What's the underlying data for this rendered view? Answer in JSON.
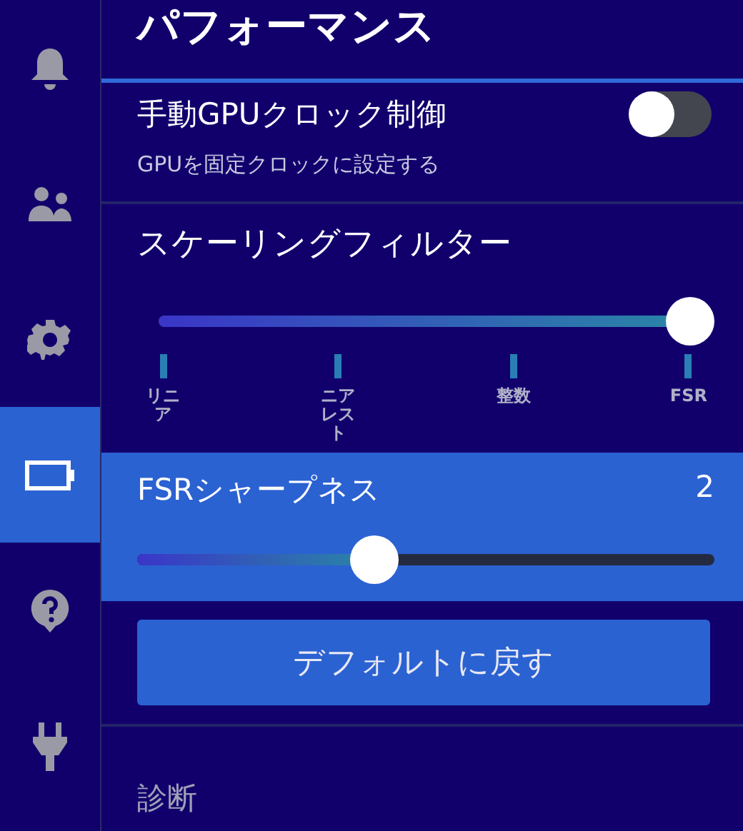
{
  "sidebar": {
    "items": [
      {
        "selected": false
      },
      {
        "selected": false
      },
      {
        "selected": false
      },
      {
        "selected": true
      },
      {
        "selected": false
      },
      {
        "selected": false
      }
    ]
  },
  "title": "パフォーマンス",
  "gpu_clock": {
    "label": "手動GPUクロック制御",
    "description": "GPUを固定クロックに設定する",
    "on": false
  },
  "scaling_filter": {
    "label": "スケーリングフィルター",
    "level": 1,
    "ticks": [
      "リニア",
      "ニアレスト",
      "整数",
      "FSR"
    ]
  },
  "fsr_sharpness": {
    "label": "FSRシャープネス",
    "value": "2",
    "level": 0.41,
    "highlighted": true
  },
  "reset_button": "デフォルトに戻す",
  "diagnostics": "診断"
}
